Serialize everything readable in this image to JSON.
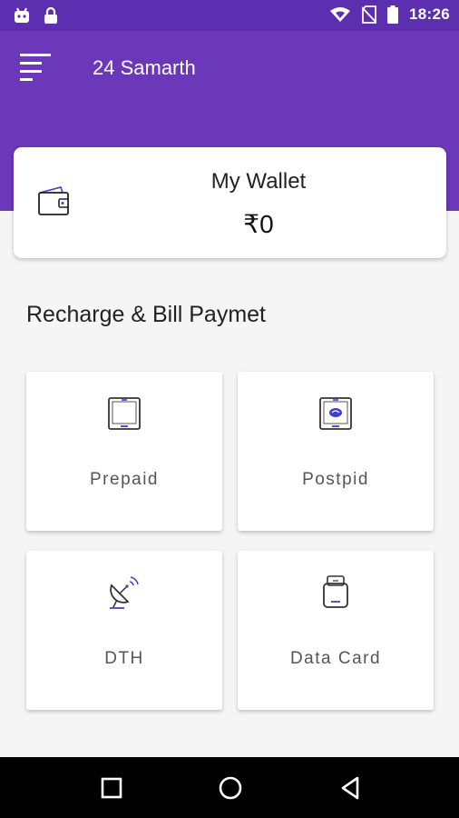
{
  "status_bar": {
    "time": "18:26",
    "icons": [
      "android-icon",
      "lock-icon",
      "wifi-icon",
      "no-sim-icon",
      "battery-icon"
    ]
  },
  "app_bar": {
    "title": "24 Samarth",
    "menu_icon": "menu-icon"
  },
  "wallet": {
    "title": "My Wallet",
    "amount": "₹0",
    "icon": "wallet-icon"
  },
  "section": {
    "title": "Recharge & Bill Paymet"
  },
  "services": [
    {
      "label": "Prepaid",
      "icon": "tablet-icon"
    },
    {
      "label": "Postpid",
      "icon": "phone-card-icon"
    },
    {
      "label": "DTH",
      "icon": "satellite-dish-icon"
    },
    {
      "label": "Data Card",
      "icon": "data-card-icon"
    }
  ],
  "nav_bar": {
    "icons": [
      "recents-icon",
      "home-icon",
      "back-icon"
    ]
  },
  "colors": {
    "primary": "#6a38b8",
    "status_bar": "#5b2fb0",
    "icon_accent": "#3b3fd8"
  }
}
